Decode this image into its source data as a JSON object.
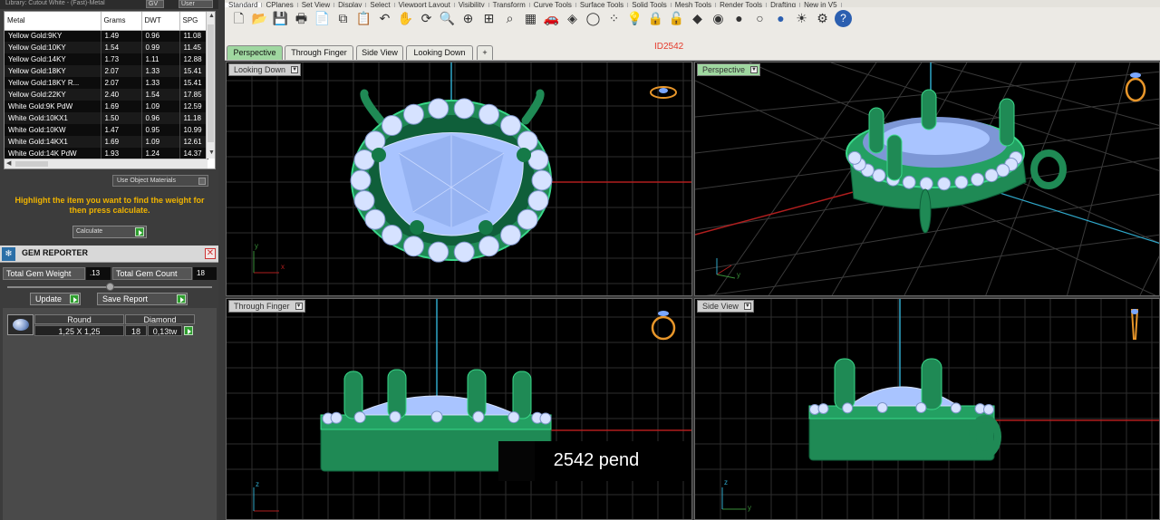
{
  "library": {
    "text": "Library: Cutout White - (Fast)-Metal",
    "btn1": "GV",
    "btn2": "User"
  },
  "metal_table": {
    "headers": [
      "Metal",
      "Grams",
      "DWT",
      "SPG"
    ],
    "rows": [
      [
        "Yellow Gold:9KY",
        "1.49",
        "0.96",
        "11.08"
      ],
      [
        "Yellow Gold:10KY",
        "1.54",
        "0.99",
        "11.45"
      ],
      [
        "Yellow Gold:14KY",
        "1.73",
        "1.11",
        "12.88"
      ],
      [
        "Yellow Gold:18KY",
        "2.07",
        "1.33",
        "15.41"
      ],
      [
        "Yellow Gold:18KY R...",
        "2.07",
        "1.33",
        "15.41"
      ],
      [
        "Yellow Gold:22KY",
        "2.40",
        "1.54",
        "17.85"
      ],
      [
        "White Gold:9K PdW",
        "1.69",
        "1.09",
        "12.59"
      ],
      [
        "White Gold:10KX1",
        "1.50",
        "0.96",
        "11.18"
      ],
      [
        "White Gold:10KW",
        "1.47",
        "0.95",
        "10.99"
      ],
      [
        "White Gold:14KX1",
        "1.69",
        "1.09",
        "12.61"
      ],
      [
        "White Gold:14K PdW",
        "1.93",
        "1.24",
        "14.37"
      ]
    ]
  },
  "use_object_materials": "Use Object Materials",
  "hint": "Highlight the item you want to find the weight for then press calculate.",
  "calculate_label": "Calculate",
  "gem_reporter": {
    "title": "GEM REPORTER",
    "total_weight_label": "Total Gem Weight",
    "total_weight_value": ".13",
    "total_count_label": "Total Gem Count",
    "total_count_value": "18",
    "update_label": "Update",
    "save_label": "Save Report",
    "table_headers": [
      "Round",
      "Diamond"
    ],
    "row": {
      "size": "1,25 X 1,25",
      "count": "18",
      "weight": "0,13tw"
    }
  },
  "toolbar_tabs": [
    "Standard",
    "CPlanes",
    "Set View",
    "Display",
    "Select",
    "Viewport Layout",
    "Visibility",
    "Transform",
    "Curve Tools",
    "Surface Tools",
    "Solid Tools",
    "Mesh Tools",
    "Render Tools",
    "Drafting",
    "New in V5"
  ],
  "toolbar_icons": [
    "new-file-icon",
    "open-file-icon",
    "save-icon",
    "print-icon",
    "import-icon",
    "copy-icon",
    "paste-icon",
    "undo-icon",
    "pan-icon",
    "rotate-view-icon",
    "zoom-icon",
    "zoom-window-icon",
    "zoom-extents-icon",
    "zoom-selected-icon",
    "four-view-icon",
    "car-render-icon",
    "cplane-icon",
    "circle-select-icon",
    "points-icon",
    "lightbulb-icon",
    "lock-icon",
    "unlock-icon",
    "material-icon",
    "color-wheel-icon",
    "shaded-sphere-icon",
    "rendered-sphere-icon",
    "blue-sphere-icon",
    "sun-tool-icon",
    "options-icon",
    "help-icon"
  ],
  "viewport_tabs": [
    "Perspective",
    "Through Finger",
    "Side View",
    "Looking Down"
  ],
  "document_id": "ID2542",
  "viewports": {
    "top_left": "Looking Down",
    "top_right": "Perspective",
    "bottom_left": "Through Finger",
    "bottom_right": "Side View"
  },
  "axes": {
    "x": "x",
    "y": "y",
    "z": "z"
  },
  "overlay_text": "2542 pend",
  "colors": {
    "metal_green": "#1f8a55",
    "gem_blue": "#a9c4ff",
    "grid": "#2a2a2a",
    "x_axis": "#b01e1e",
    "accent_orange": "#f0b400",
    "id_red": "#e53b2c"
  }
}
